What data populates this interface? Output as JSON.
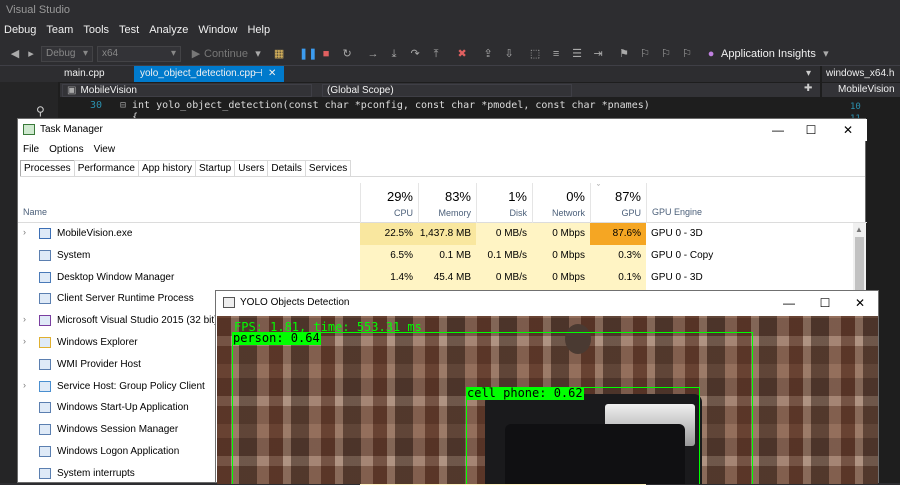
{
  "vs": {
    "title": "Visual Studio",
    "menu": [
      "Debug",
      "Team",
      "Tools",
      "Test",
      "Analyze",
      "Window",
      "Help"
    ],
    "toolbar": {
      "config": "Debug",
      "platform": "x64",
      "continue_label": "Continue",
      "app_insights": "Application Insights"
    },
    "tabs": {
      "main": "main.cpp",
      "active": "yolo_object_detection.cpp",
      "right": "windows_x64.h"
    },
    "nav": {
      "project": "MobileVision",
      "scope": "(Global Scope)",
      "right_project": "MobileVision"
    },
    "code": {
      "line_number": "30",
      "line_text": "int yolo_object_detection(const char *pconfig, const char *pmodel, const char *pnames)",
      "line_number_2": "",
      "line_text_2": "{"
    },
    "right_code": {
      "line1": "10",
      "line2": "11"
    }
  },
  "task_manager": {
    "title": "Task Manager",
    "menu": [
      "File",
      "Options",
      "View"
    ],
    "tabs": [
      "Processes",
      "Performance",
      "App history",
      "Startup",
      "Users",
      "Details",
      "Services"
    ],
    "active_tab": "Processes",
    "columns": {
      "name": "Name",
      "cpu": {
        "pct": "29%",
        "label": "CPU"
      },
      "memory": {
        "pct": "83%",
        "label": "Memory"
      },
      "disk": {
        "pct": "1%",
        "label": "Disk"
      },
      "network": {
        "pct": "0%",
        "label": "Network"
      },
      "gpu": {
        "pct": "87%",
        "label": "GPU"
      },
      "gpu_engine": "GPU Engine"
    },
    "processes": [
      {
        "name": "MobileVision.exe",
        "expand": true,
        "cpu": "22.5%",
        "memory": "1,437.8 MB",
        "disk": "0 MB/s",
        "network": "0 Mbps",
        "gpu": "87.6%",
        "engine": "GPU 0 - 3D"
      },
      {
        "name": "System",
        "expand": false,
        "cpu": "6.5%",
        "memory": "0.1 MB",
        "disk": "0.1 MB/s",
        "network": "0 Mbps",
        "gpu": "0.3%",
        "engine": "GPU 0 - Copy"
      },
      {
        "name": "Desktop Window Manager",
        "expand": false,
        "cpu": "1.4%",
        "memory": "45.4 MB",
        "disk": "0 MB/s",
        "network": "0 Mbps",
        "gpu": "0.1%",
        "engine": "GPU 0 - 3D"
      },
      {
        "name": "Client Server Runtime Process",
        "expand": false
      },
      {
        "name": "Microsoft Visual Studio 2015 (32 bit) (12)",
        "expand": true
      },
      {
        "name": "Windows Explorer",
        "expand": true
      },
      {
        "name": "WMI Provider Host",
        "expand": false
      },
      {
        "name": "Service Host: Group Policy Client",
        "expand": true
      },
      {
        "name": "Windows Start-Up Application",
        "expand": false
      },
      {
        "name": "Windows Session Manager",
        "expand": false
      },
      {
        "name": "Windows Logon Application",
        "expand": false
      },
      {
        "name": "System interrupts",
        "expand": false
      }
    ]
  },
  "yolo": {
    "title": "YOLO Objects Detection",
    "fps_text": "FPS: 1.81, time: 553.31 ms",
    "detections": [
      {
        "label": "person: 0.64"
      },
      {
        "label": "cell phone: 0.62"
      }
    ]
  },
  "colors": {
    "detection": "#00ff00",
    "heat_light": "#fff4c4",
    "heat_mid": "#f9e79f",
    "heat_high": "#f5a623"
  }
}
